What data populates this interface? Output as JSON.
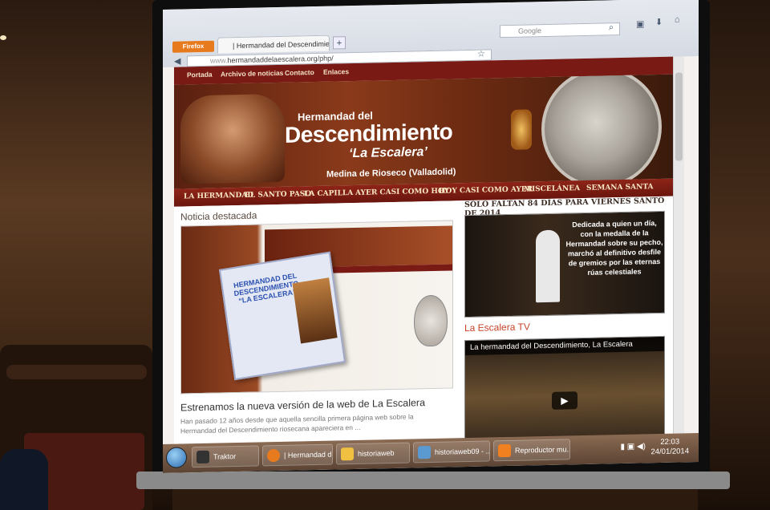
{
  "browser": {
    "firefox_label": "Firefox",
    "tab_title": "| Hermandad del Descendimiento",
    "new_tab": "+",
    "url_host": "www.",
    "url_path": "hermandaddelaescalera.org/php/",
    "search_placeholder": "Google"
  },
  "site": {
    "top_nav": [
      "Portada",
      "Archivo de noticias",
      "Contacto",
      "Enlaces"
    ],
    "banner": {
      "line1": "Hermandad del",
      "line2": "Descendimiento",
      "line3": "‘La Escalera’",
      "line4": "Medina de Rioseco (Valladolid)"
    },
    "menu": [
      "LA HERMANDAD",
      "EL SANTO PASO",
      "LA CAPILLA",
      "AYER CASI COMO HOY",
      "HOY CASI COMO AYER",
      "MISCELÁNEA",
      "SEMANA SANTA"
    ],
    "featured": {
      "section_title": "Noticia destacada",
      "mini_title": "HERMANDAD DEL DESCENDIMIENTO “LA ESCALERA”",
      "title": "Estrenamos la nueva versión de la web de La Escalera",
      "text": "Han pasado 12 años desde que aquella sencilla primera página web sobre la Hermandad del Descendimiento riosecana apareciera en ..."
    },
    "countdown": "SÓLO FALTAN 84 DÍAS PARA VIERNES SANTO DE 2014",
    "side_quote": "Dedicada a quien un día, con la medalla de la Hermandad sobre su pecho, marchó al definitivo desfile de gremios por las eternas rúas celestiales",
    "tv_title": "La Escalera TV",
    "video_title": "La hermandad del Descendimiento, La Escalera"
  },
  "taskbar": {
    "items": [
      "Traktor",
      "| Hermandad d...",
      "historiaweb",
      "historiaweb09 - ...",
      "Reproductor mu..."
    ],
    "time": "22:03",
    "date": "24/01/2014"
  }
}
